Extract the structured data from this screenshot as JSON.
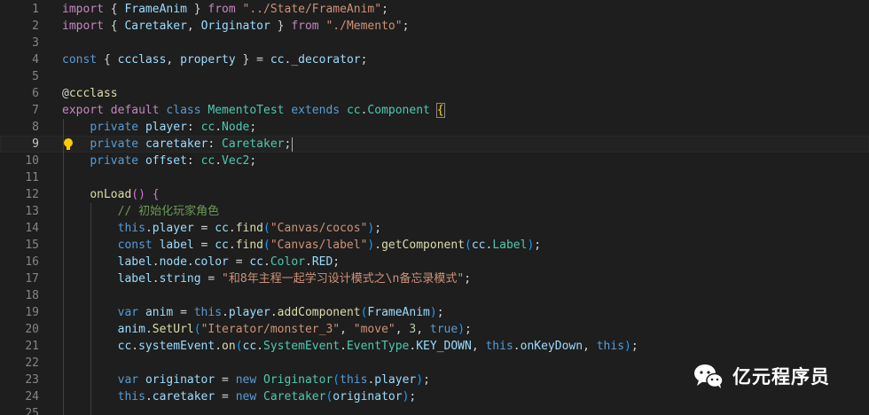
{
  "editor": {
    "language": "TypeScript",
    "current_line": 9,
    "lines": [
      {
        "n": 1,
        "tokens": [
          [
            "import",
            "ctl"
          ],
          [
            " ",
            "pun"
          ],
          [
            "{",
            "pun"
          ],
          [
            " ",
            "pun"
          ],
          [
            "FrameAnim",
            "var"
          ],
          [
            " ",
            "pun"
          ],
          [
            "}",
            "pun"
          ],
          [
            " ",
            "pun"
          ],
          [
            "from",
            "ctl"
          ],
          [
            " ",
            "pun"
          ],
          [
            "\"../State/FrameAnim\"",
            "str"
          ],
          [
            ";",
            "pun"
          ]
        ]
      },
      {
        "n": 2,
        "tokens": [
          [
            "import",
            "ctl"
          ],
          [
            " ",
            "pun"
          ],
          [
            "{",
            "pun"
          ],
          [
            " ",
            "pun"
          ],
          [
            "Caretaker",
            "var"
          ],
          [
            ", ",
            "pun"
          ],
          [
            "Originator",
            "var"
          ],
          [
            " ",
            "pun"
          ],
          [
            "}",
            "pun"
          ],
          [
            " ",
            "pun"
          ],
          [
            "from",
            "ctl"
          ],
          [
            " ",
            "pun"
          ],
          [
            "\"./Memento\"",
            "str"
          ],
          [
            ";",
            "pun"
          ]
        ]
      },
      {
        "n": 3,
        "tokens": []
      },
      {
        "n": 4,
        "tokens": [
          [
            "const",
            "kw"
          ],
          [
            " ",
            "pun"
          ],
          [
            "{",
            "pun"
          ],
          [
            " ",
            "pun"
          ],
          [
            "ccclass",
            "var"
          ],
          [
            ", ",
            "pun"
          ],
          [
            "property",
            "var"
          ],
          [
            " ",
            "pun"
          ],
          [
            "}",
            "pun"
          ],
          [
            " = ",
            "pun"
          ],
          [
            "cc",
            "var"
          ],
          [
            ".",
            "pun"
          ],
          [
            "_decorator",
            "var"
          ],
          [
            ";",
            "pun"
          ]
        ]
      },
      {
        "n": 5,
        "tokens": []
      },
      {
        "n": 6,
        "tokens": [
          [
            "@",
            "pun"
          ],
          [
            "ccclass",
            "fn"
          ]
        ]
      },
      {
        "n": 7,
        "tokens": [
          [
            "export",
            "ctl"
          ],
          [
            " ",
            "pun"
          ],
          [
            "default",
            "ctl"
          ],
          [
            " ",
            "pun"
          ],
          [
            "class",
            "kw"
          ],
          [
            " ",
            "pun"
          ],
          [
            "MementoTest",
            "cls"
          ],
          [
            " ",
            "pun"
          ],
          [
            "extends",
            "kw"
          ],
          [
            " ",
            "pun"
          ],
          [
            "cc",
            "cls"
          ],
          [
            ".",
            "pun"
          ],
          [
            "Component",
            "cls"
          ],
          [
            " ",
            "pun"
          ],
          [
            "{",
            "br1 bracket-hl"
          ]
        ]
      },
      {
        "n": 8,
        "tokens": [
          [
            "    ",
            "pun"
          ],
          [
            "private",
            "kw"
          ],
          [
            " ",
            "pun"
          ],
          [
            "player",
            "var"
          ],
          [
            ": ",
            "pun"
          ],
          [
            "cc",
            "cls"
          ],
          [
            ".",
            "pun"
          ],
          [
            "Node",
            "cls"
          ],
          [
            ";",
            "pun"
          ]
        ]
      },
      {
        "n": 9,
        "tokens": [
          [
            "    ",
            "pun"
          ],
          [
            "private",
            "kw"
          ],
          [
            " ",
            "pun"
          ],
          [
            "caretaker",
            "var"
          ],
          [
            ": ",
            "pun"
          ],
          [
            "Caretaker",
            "cls"
          ],
          [
            ";",
            "pun"
          ]
        ]
      },
      {
        "n": 10,
        "tokens": [
          [
            "    ",
            "pun"
          ],
          [
            "private",
            "kw"
          ],
          [
            " ",
            "pun"
          ],
          [
            "offset",
            "var"
          ],
          [
            ": ",
            "pun"
          ],
          [
            "cc",
            "cls"
          ],
          [
            ".",
            "pun"
          ],
          [
            "Vec2",
            "cls"
          ],
          [
            ";",
            "pun"
          ]
        ]
      },
      {
        "n": 11,
        "tokens": []
      },
      {
        "n": 12,
        "tokens": [
          [
            "    ",
            "pun"
          ],
          [
            "onLoad",
            "fn"
          ],
          [
            "()",
            "br2"
          ],
          [
            " ",
            "pun"
          ],
          [
            "{",
            "br2"
          ]
        ]
      },
      {
        "n": 13,
        "tokens": [
          [
            "        ",
            "pun"
          ],
          [
            "// 初始化玩家角色",
            "cmt"
          ]
        ]
      },
      {
        "n": 14,
        "tokens": [
          [
            "        ",
            "pun"
          ],
          [
            "this",
            "kw"
          ],
          [
            ".",
            "pun"
          ],
          [
            "player",
            "var"
          ],
          [
            " = ",
            "pun"
          ],
          [
            "cc",
            "var"
          ],
          [
            ".",
            "pun"
          ],
          [
            "find",
            "fn"
          ],
          [
            "(",
            "br3"
          ],
          [
            "\"Canvas/cocos\"",
            "str"
          ],
          [
            ")",
            "br3"
          ],
          [
            ";",
            "pun"
          ]
        ]
      },
      {
        "n": 15,
        "tokens": [
          [
            "        ",
            "pun"
          ],
          [
            "const",
            "kw"
          ],
          [
            " ",
            "pun"
          ],
          [
            "label",
            "var"
          ],
          [
            " = ",
            "pun"
          ],
          [
            "cc",
            "var"
          ],
          [
            ".",
            "pun"
          ],
          [
            "find",
            "fn"
          ],
          [
            "(",
            "br3"
          ],
          [
            "\"Canvas/label\"",
            "str"
          ],
          [
            ")",
            "br3"
          ],
          [
            ".",
            "pun"
          ],
          [
            "getComponent",
            "fn"
          ],
          [
            "(",
            "br3"
          ],
          [
            "cc",
            "var"
          ],
          [
            ".",
            "pun"
          ],
          [
            "Label",
            "cls"
          ],
          [
            ")",
            "br3"
          ],
          [
            ";",
            "pun"
          ]
        ]
      },
      {
        "n": 16,
        "tokens": [
          [
            "        ",
            "pun"
          ],
          [
            "label",
            "var"
          ],
          [
            ".",
            "pun"
          ],
          [
            "node",
            "var"
          ],
          [
            ".",
            "pun"
          ],
          [
            "color",
            "var"
          ],
          [
            " = ",
            "pun"
          ],
          [
            "cc",
            "var"
          ],
          [
            ".",
            "pun"
          ],
          [
            "Color",
            "cls"
          ],
          [
            ".",
            "pun"
          ],
          [
            "RED",
            "var"
          ],
          [
            ";",
            "pun"
          ]
        ]
      },
      {
        "n": 17,
        "tokens": [
          [
            "        ",
            "pun"
          ],
          [
            "label",
            "var"
          ],
          [
            ".",
            "pun"
          ],
          [
            "string",
            "var"
          ],
          [
            " = ",
            "pun"
          ],
          [
            "\"和8年主程一起学习设计模式之\\n备忘录模式\"",
            "str"
          ],
          [
            ";",
            "pun"
          ]
        ]
      },
      {
        "n": 18,
        "tokens": []
      },
      {
        "n": 19,
        "tokens": [
          [
            "        ",
            "pun"
          ],
          [
            "var",
            "kw"
          ],
          [
            " ",
            "pun"
          ],
          [
            "anim",
            "var"
          ],
          [
            " = ",
            "pun"
          ],
          [
            "this",
            "kw"
          ],
          [
            ".",
            "pun"
          ],
          [
            "player",
            "var"
          ],
          [
            ".",
            "pun"
          ],
          [
            "addComponent",
            "fn"
          ],
          [
            "(",
            "br3"
          ],
          [
            "FrameAnim",
            "var"
          ],
          [
            ")",
            "br3"
          ],
          [
            ";",
            "pun"
          ]
        ]
      },
      {
        "n": 20,
        "tokens": [
          [
            "        ",
            "pun"
          ],
          [
            "anim",
            "var"
          ],
          [
            ".",
            "pun"
          ],
          [
            "SetUrl",
            "fn"
          ],
          [
            "(",
            "br3"
          ],
          [
            "\"Iterator/monster_3\"",
            "str"
          ],
          [
            ", ",
            "pun"
          ],
          [
            "\"move\"",
            "str"
          ],
          [
            ", ",
            "pun"
          ],
          [
            "3",
            "num"
          ],
          [
            ", ",
            "pun"
          ],
          [
            "true",
            "kw"
          ],
          [
            ")",
            "br3"
          ],
          [
            ";",
            "pun"
          ]
        ]
      },
      {
        "n": 21,
        "tokens": [
          [
            "        ",
            "pun"
          ],
          [
            "cc",
            "var"
          ],
          [
            ".",
            "pun"
          ],
          [
            "systemEvent",
            "var"
          ],
          [
            ".",
            "pun"
          ],
          [
            "on",
            "fn"
          ],
          [
            "(",
            "br3"
          ],
          [
            "cc",
            "var"
          ],
          [
            ".",
            "pun"
          ],
          [
            "SystemEvent",
            "cls"
          ],
          [
            ".",
            "pun"
          ],
          [
            "EventType",
            "cls"
          ],
          [
            ".",
            "pun"
          ],
          [
            "KEY_DOWN",
            "var"
          ],
          [
            ", ",
            "pun"
          ],
          [
            "this",
            "kw"
          ],
          [
            ".",
            "pun"
          ],
          [
            "onKeyDown",
            "var"
          ],
          [
            ", ",
            "pun"
          ],
          [
            "this",
            "kw"
          ],
          [
            ")",
            "br3"
          ],
          [
            ";",
            "pun"
          ]
        ]
      },
      {
        "n": 22,
        "tokens": []
      },
      {
        "n": 23,
        "tokens": [
          [
            "        ",
            "pun"
          ],
          [
            "var",
            "kw"
          ],
          [
            " ",
            "pun"
          ],
          [
            "originator",
            "var"
          ],
          [
            " = ",
            "pun"
          ],
          [
            "new",
            "kw"
          ],
          [
            " ",
            "pun"
          ],
          [
            "Originator",
            "cls"
          ],
          [
            "(",
            "br3"
          ],
          [
            "this",
            "kw"
          ],
          [
            ".",
            "pun"
          ],
          [
            "player",
            "var"
          ],
          [
            ")",
            "br3"
          ],
          [
            ";",
            "pun"
          ]
        ]
      },
      {
        "n": 24,
        "tokens": [
          [
            "        ",
            "pun"
          ],
          [
            "this",
            "kw"
          ],
          [
            ".",
            "pun"
          ],
          [
            "caretaker",
            "var"
          ],
          [
            " = ",
            "pun"
          ],
          [
            "new",
            "kw"
          ],
          [
            " ",
            "pun"
          ],
          [
            "Caretaker",
            "cls"
          ],
          [
            "(",
            "br3"
          ],
          [
            "originator",
            "var"
          ],
          [
            ")",
            "br3"
          ],
          [
            ";",
            "pun"
          ]
        ]
      },
      {
        "n": 25,
        "tokens": []
      }
    ]
  },
  "watermark": {
    "text": "亿元程序员",
    "icon": "wechat-icon"
  },
  "lightbulb": {
    "icon": "lightbulb-icon",
    "line": 9
  }
}
